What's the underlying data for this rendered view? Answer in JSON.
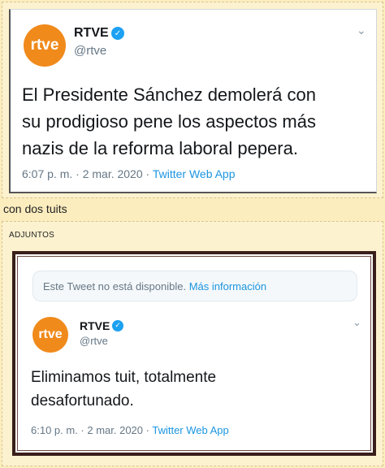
{
  "tweet_top": {
    "avatar_text": "rtve",
    "name": "RTVE",
    "handle": "@rtve",
    "text_line1": "El Presidente Sánchez demolerá con",
    "text_line2": "su prodigioso pene los aspectos más",
    "text_line3": "nazis de la reforma laboral pepera.",
    "timestamp": "6:07 p. m. · 2 mar. 2020 · ",
    "app": "Twitter Web App"
  },
  "caption": "con dos tuits",
  "attachments": {
    "label": "ADJUNTOS",
    "unavailable_text": "Este Tweet no está disponible. ",
    "unavailable_link": "Más información",
    "tweet": {
      "avatar_text": "rtve",
      "name": "RTVE",
      "handle": "@rtve",
      "text_line1": "Eliminamos tuit, totalmente",
      "text_line2": "desafortunado.",
      "timestamp": "6:10 p. m. · 2 mar. 2020 · ",
      "app": "Twitter Web App"
    }
  },
  "colors": {
    "page_bg": "#fcedbf",
    "rtve_orange": "#f08a1b",
    "verified_blue": "#1da1f2",
    "link_blue": "#1b95e0"
  }
}
